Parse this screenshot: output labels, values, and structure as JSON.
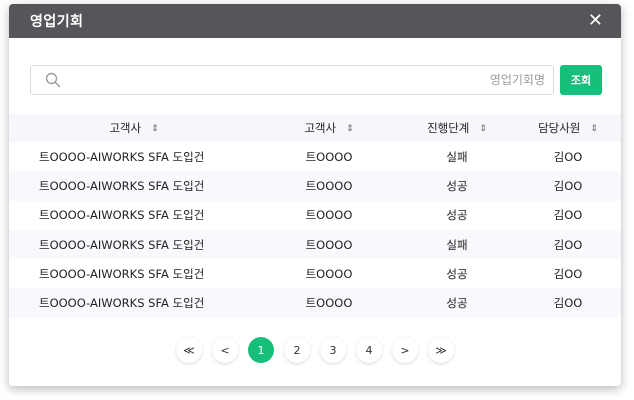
{
  "modal": {
    "title": "영업기회",
    "close_label": "✕"
  },
  "search": {
    "placeholder": "영업기회명",
    "value": "",
    "button_label": "조회"
  },
  "table": {
    "headers": [
      "고객사",
      "고객사",
      "진행단계",
      "담당사원"
    ],
    "sort_glyph": "⇕",
    "rows": [
      [
        "트OOOO-AIWORKS SFA 도입건",
        "트OOOO",
        "실패",
        "김OO"
      ],
      [
        "트OOOO-AIWORKS SFA 도입건",
        "트OOOO",
        "성공",
        "김OO"
      ],
      [
        "트OOOO-AIWORKS SFA 도입건",
        "트OOOO",
        "성공",
        "김OO"
      ],
      [
        "트OOOO-AIWORKS SFA 도입건",
        "트OOOO",
        "실패",
        "김OO"
      ],
      [
        "트OOOO-AIWORKS SFA 도입건",
        "트OOOO",
        "성공",
        "김OO"
      ],
      [
        "트OOOO-AIWORKS SFA 도입건",
        "트OOOO",
        "성공",
        "김OO"
      ]
    ]
  },
  "pagination": {
    "first": "≪",
    "prev": "<",
    "next": ">",
    "last": "≫",
    "pages": [
      "1",
      "2",
      "3",
      "4"
    ],
    "current": "1"
  },
  "colors": {
    "accent": "#17c07a",
    "header_bg": "#55565a"
  }
}
